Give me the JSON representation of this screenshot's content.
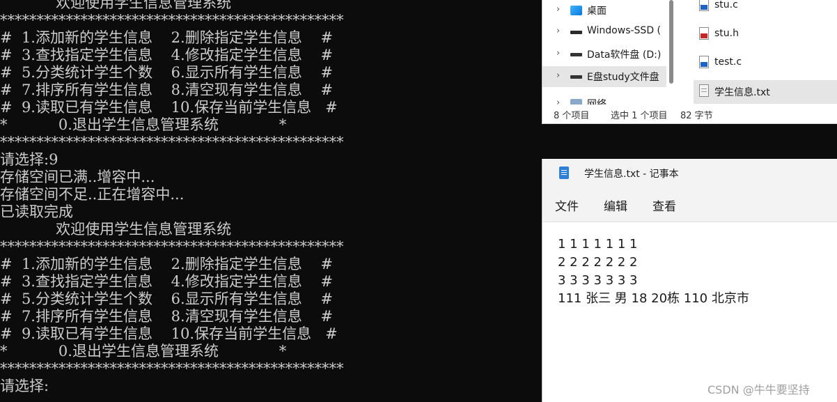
{
  "console": {
    "lines": [
      "            欢迎使用学生信息管理系统",
      "***********************************************",
      "#  1.添加新的学生信息    2.删除指定学生信息    #",
      "#  3.查找指定学生信息    4.修改指定学生信息    #",
      "#  5.分类统计学生个数    6.显示所有学生信息    #",
      "#  7.排序所有学生信息    8.清空现有学生信息    #",
      "#  9.读取已有学生信息    10.保存当前学生信息   #",
      "*           0.退出学生信息管理系统             *",
      "***********************************************",
      "请选择:9",
      "存储空间已满..增容中...",
      "存储空间不足..正在增容中...",
      "已读取完成",
      "            欢迎使用学生信息管理系统",
      "***********************************************",
      "#  1.添加新的学生信息    2.删除指定学生信息    #",
      "#  3.查找指定学生信息    4.修改指定学生信息    #",
      "#  5.分类统计学生个数    6.显示所有学生信息    #",
      "#  7.排序所有学生信息    8.清空现有学生信息    #",
      "#  9.读取已有学生信息    10.保存当前学生信息   #",
      "*           0.退出学生信息管理系统             *",
      "***********************************************",
      "请选择:"
    ]
  },
  "explorer": {
    "tree": [
      {
        "label": "桌面",
        "icon": "desktop-icon"
      },
      {
        "label": "Windows-SSD (",
        "icon": "windows-drive-icon"
      },
      {
        "label": "Data软件盘 (D:)",
        "icon": "drive-icon"
      },
      {
        "label": "E盘study文件盘",
        "icon": "drive-icon"
      },
      {
        "label": "网络",
        "icon": "network-icon"
      }
    ],
    "files": [
      {
        "name": "stu.c",
        "type": "c"
      },
      {
        "name": "stu.h",
        "type": "h"
      },
      {
        "name": "test.c",
        "type": "c"
      },
      {
        "name": "学生信息.txt",
        "type": "txt"
      }
    ],
    "status": {
      "count": "8 个项目",
      "selection": "选中 1 个项目",
      "size": "82 字节"
    }
  },
  "notepad": {
    "title": "学生信息.txt - 记事本",
    "menu": [
      "文件",
      "编辑",
      "查看"
    ],
    "lines": [
      "1 1 1 1 1 1 1",
      "2 2 2 2 2 2 2",
      "3 3 3 3 3 3 3",
      "111 张三 男 18 20栋 110 北京市"
    ]
  },
  "watermark": "CSDN @牛牛要坚持"
}
